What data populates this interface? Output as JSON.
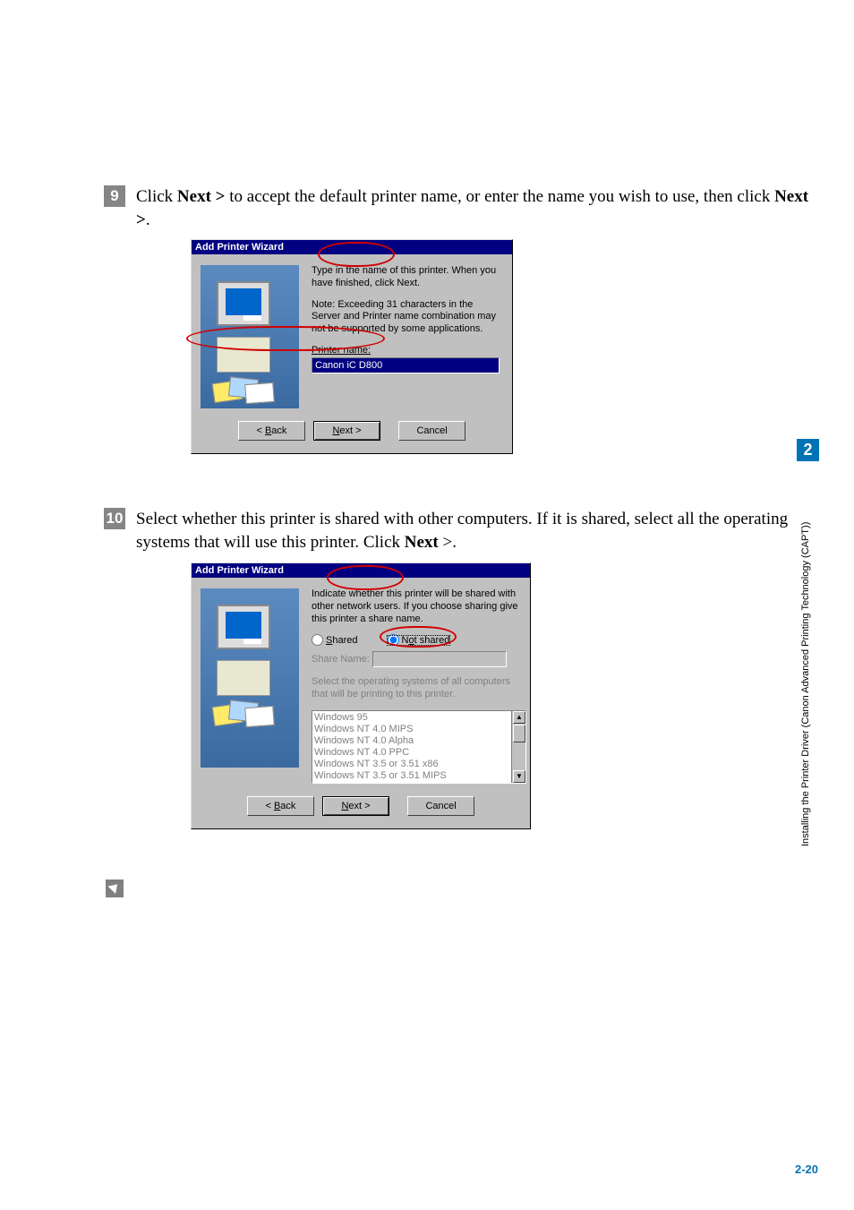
{
  "sidebar": {
    "chapter_number": "2",
    "chapter_title": "Installing the Printer Driver (Canon Advanced Printing Technology (CAPT))"
  },
  "page_number": "2-20",
  "step9": {
    "number": "9",
    "text_before": "Click ",
    "bold1": "Next >",
    "text_mid": " to accept the default printer name, or enter the name you wish to use, then click ",
    "bold2": "Next >",
    "text_after": "."
  },
  "step10": {
    "number": "10",
    "text_before": "Select whether this printer is shared with other computers. If it is shared, select all the operating systems that will use this printer. Click ",
    "bold1": "Next",
    "text_after": " >."
  },
  "dialog1": {
    "title": "Add Printer Wizard",
    "msg1": "Type in the name of this printer.  When you have finished, click Next.",
    "msg2": "Note:  Exceeding 31 characters in the Server and Printer name combination may not be supported by some applications.",
    "field_label_pre": "P",
    "field_label_rest": "rinter name:",
    "field_value": "Canon iC D800",
    "btn_back": "< Back",
    "btn_back_ul": "B",
    "btn_next_ul": "N",
    "btn_next_rest": "ext >",
    "btn_cancel": "Cancel"
  },
  "dialog2": {
    "title": "Add Printer Wizard",
    "msg1": "Indicate whether this printer will be shared with other network users.  If you choose sharing give this printer a share name.",
    "radio_shared_ul": "S",
    "radio_shared_rest": "hared",
    "radio_notshared_pre": "N",
    "radio_notshared_ul": "o",
    "radio_notshared_rest": "t shared",
    "share_name_label": "Share Name:",
    "msg2": "Select the operating systems of all computers that will be printing to this printer.",
    "os": [
      "Windows 95",
      "Windows NT 4.0 MIPS",
      "Windows NT 4.0 Alpha",
      "Windows NT 4.0 PPC",
      "Windows NT 3.5 or 3.51 x86",
      "Windows NT 3.5 or 3.51 MIPS"
    ],
    "btn_back": "< Back",
    "btn_back_ul": "B",
    "btn_next_ul": "N",
    "btn_next_rest": "ext >",
    "btn_cancel": "Cancel"
  }
}
